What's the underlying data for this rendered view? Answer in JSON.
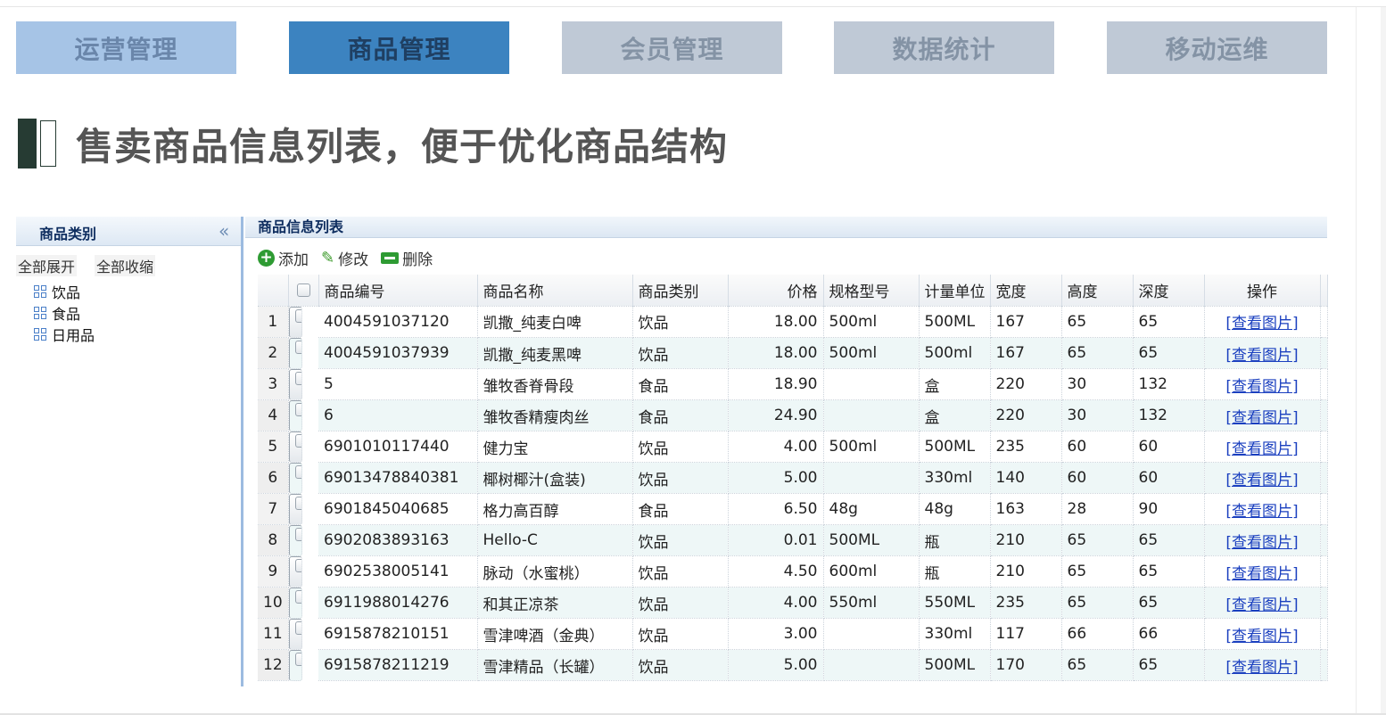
{
  "nav": {
    "tabs": [
      {
        "label": "运营管理",
        "bg": "#a6c4e6",
        "color": "#6a86aa"
      },
      {
        "label": "商品管理",
        "bg": "#3c83c0",
        "color": "#1f3f62"
      },
      {
        "label": "会员管理",
        "bg": "#bfc9d6",
        "color": "#8493a5"
      },
      {
        "label": "数据统计",
        "bg": "#bfc9d6",
        "color": "#8493a5"
      },
      {
        "label": "移动运维",
        "bg": "#bfc9d6",
        "color": "#8493a5"
      }
    ],
    "active_index": 1
  },
  "section": {
    "title": "售卖商品信息列表，便于优化商品结构"
  },
  "left_panel": {
    "title": "商品类别",
    "collapse_icon": "double-chevron-left-icon",
    "expand_all": "全部展开",
    "collapse_all": "全部收缩",
    "categories": [
      "饮品",
      "食品",
      "日用品"
    ]
  },
  "grid": {
    "title": "商品信息列表",
    "toolbar": {
      "add": "添加",
      "edit": "修改",
      "delete": "删除"
    },
    "columns": [
      "商品编号",
      "商品名称",
      "商品类别",
      "价格",
      "规格型号",
      "计量单位",
      "宽度",
      "高度",
      "深度",
      "操作"
    ],
    "rows": [
      {
        "n": "1",
        "code": "4004591037120",
        "name": "凯撒_纯麦白啤",
        "cat": "饮品",
        "price": "18.00",
        "spec": "500ml",
        "unit": "500ML",
        "w": "167",
        "h": "65",
        "d": "65",
        "op": "[查看图片]"
      },
      {
        "n": "2",
        "code": "4004591037939",
        "name": "凯撒_纯麦黑啤",
        "cat": "饮品",
        "price": "18.00",
        "spec": "500ml",
        "unit": "500ml",
        "w": "167",
        "h": "65",
        "d": "65",
        "op": "[查看图片]"
      },
      {
        "n": "3",
        "code": "5",
        "name": "雏牧香脊骨段",
        "cat": "食品",
        "price": "18.90",
        "spec": "",
        "unit": "盒",
        "w": "220",
        "h": "30",
        "d": "132",
        "op": "[查看图片]"
      },
      {
        "n": "4",
        "code": "6",
        "name": "雏牧香精瘦肉丝",
        "cat": "食品",
        "price": "24.90",
        "spec": "",
        "unit": "盒",
        "w": "220",
        "h": "30",
        "d": "132",
        "op": "[查看图片]"
      },
      {
        "n": "5",
        "code": "6901010117440",
        "name": "健力宝",
        "cat": "饮品",
        "price": "4.00",
        "spec": "500ml",
        "unit": "500ML",
        "w": "235",
        "h": "60",
        "d": "60",
        "op": "[查看图片]"
      },
      {
        "n": "6",
        "code": "69013478840381",
        "name": "椰树椰汁(盒装)",
        "cat": "饮品",
        "price": "5.00",
        "spec": "",
        "unit": "330ml",
        "w": "140",
        "h": "60",
        "d": "60",
        "op": "[查看图片]"
      },
      {
        "n": "7",
        "code": "6901845040685",
        "name": "格力高百醇",
        "cat": "食品",
        "price": "6.50",
        "spec": "48g",
        "unit": "48g",
        "w": "163",
        "h": "28",
        "d": "90",
        "op": "[查看图片]"
      },
      {
        "n": "8",
        "code": "6902083893163",
        "name": "Hello-C",
        "cat": "饮品",
        "price": "0.01",
        "spec": "500ML",
        "unit": "瓶",
        "w": "210",
        "h": "65",
        "d": "65",
        "op": "[查看图片]"
      },
      {
        "n": "9",
        "code": "6902538005141",
        "name": "脉动（水蜜桃）",
        "cat": "饮品",
        "price": "4.50",
        "spec": "600ml",
        "unit": "瓶",
        "w": "210",
        "h": "65",
        "d": "65",
        "op": "[查看图片]"
      },
      {
        "n": "10",
        "code": "6911988014276",
        "name": "和其正凉茶",
        "cat": "饮品",
        "price": "4.00",
        "spec": "550ml",
        "unit": "550ML",
        "w": "235",
        "h": "65",
        "d": "65",
        "op": "[查看图片]"
      },
      {
        "n": "11",
        "code": "6915878210151",
        "name": "雪津啤酒（金典）",
        "cat": "饮品",
        "price": "3.00",
        "spec": "",
        "unit": "330ml",
        "w": "117",
        "h": "66",
        "d": "66",
        "op": "[查看图片]"
      },
      {
        "n": "12",
        "code": "6915878211219",
        "name": "雪津精品（长罐）",
        "cat": "饮品",
        "price": "5.00",
        "spec": "",
        "unit": "500ML",
        "w": "170",
        "h": "65",
        "d": "65",
        "op": "[查看图片]"
      }
    ]
  }
}
